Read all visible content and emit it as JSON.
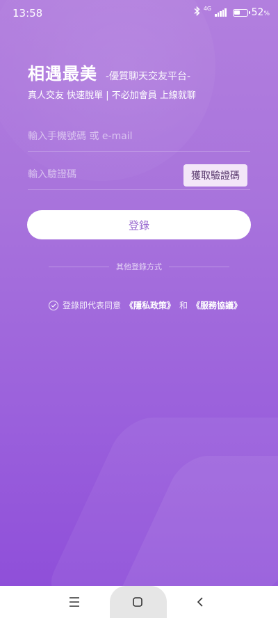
{
  "status": {
    "time": "13:58",
    "network": "4G",
    "battery_pct": "52",
    "battery_unit": "%",
    "battery_level": 0.52
  },
  "header": {
    "title": "相遇最美",
    "subtitle": "-優質聊天交友平台-",
    "tagline": "真人交友 快速脫單 | 不必加會員 上線就聊"
  },
  "form": {
    "phone_placeholder": "輸入手機號碼 或 e-mail",
    "code_placeholder": "輸入驗證碼",
    "get_code_label": "獲取驗證碼",
    "login_label": "登錄"
  },
  "other_login": {
    "label": "其他登錄方式"
  },
  "agreement": {
    "prefix": "登錄即代表同意",
    "privacy": "《隱私政策》",
    "and": "和",
    "terms": "《服務協議》"
  },
  "colors": {
    "bg_top": "#b27fde",
    "bg_bottom": "#8f4fd9",
    "get_code_bg": "#f3e6f8",
    "login_text": "#9a6ad0"
  },
  "icons": {
    "bluetooth": "bluetooth-icon",
    "signal": "signal-icon",
    "battery": "battery-icon",
    "check": "check-circle-icon",
    "menu": "menu-icon",
    "home": "home-square-icon",
    "back": "back-chevron-icon"
  }
}
